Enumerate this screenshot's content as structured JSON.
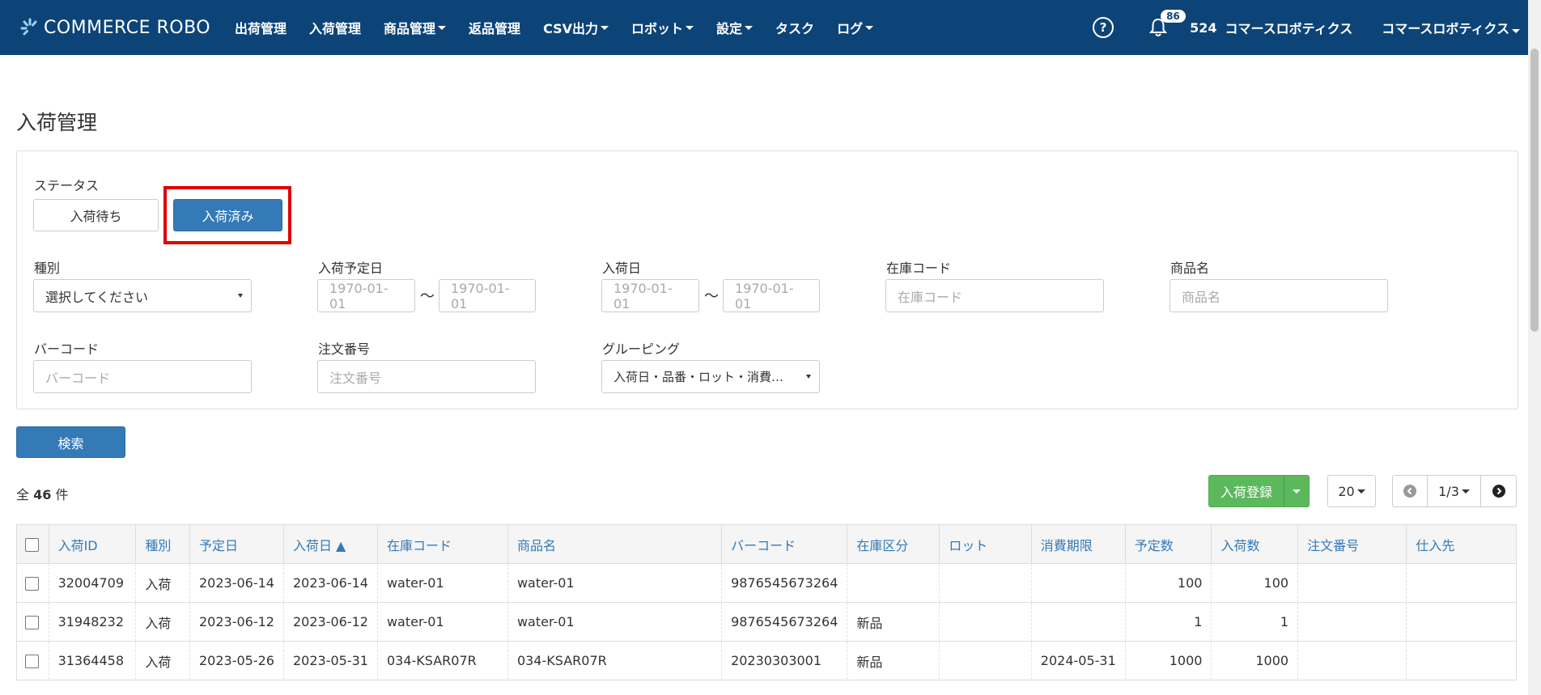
{
  "nav": {
    "brand": "COMMERCE ROBO",
    "items": [
      {
        "label": "出荷管理",
        "caret": false
      },
      {
        "label": "入荷管理",
        "caret": false
      },
      {
        "label": "商品管理",
        "caret": true
      },
      {
        "label": "返品管理",
        "caret": false
      },
      {
        "label": "CSV出力",
        "caret": true
      },
      {
        "label": "ロボット",
        "caret": true
      },
      {
        "label": "設定",
        "caret": true
      },
      {
        "label": "タスク",
        "caret": false
      },
      {
        "label": "ログ",
        "caret": true
      }
    ],
    "help_icon": "question-circle-icon",
    "bell_icon": "bell-icon",
    "notification_count": "86",
    "account_id": "524",
    "account_name": "コマースロボティクス",
    "user_menu": "コマースロボティクス"
  },
  "page": {
    "title": "入荷管理"
  },
  "filters": {
    "status_label": "ステータス",
    "status_options": [
      "入荷待ち",
      "入荷済み"
    ],
    "status_selected": "入荷済み",
    "type_label": "種別",
    "type_value": "選択してください",
    "scheduled_label": "入荷予定日",
    "scheduled_from": "1970-01-01",
    "scheduled_to": "1970-01-01",
    "arrival_label": "入荷日",
    "arrival_from": "1970-01-01",
    "arrival_to": "1970-01-01",
    "stock_code_label": "在庫コード",
    "stock_code_placeholder": "在庫コード",
    "product_name_label": "商品名",
    "product_name_placeholder": "商品名",
    "barcode_label": "バーコード",
    "barcode_placeholder": "バーコード",
    "order_no_label": "注文番号",
    "order_no_placeholder": "注文番号",
    "grouping_label": "グルーピング",
    "grouping_value": "入荷日・品番・ロット・消費…",
    "range_sep": "〜",
    "search_button": "検索"
  },
  "results": {
    "total_prefix": "全",
    "total_count": "46",
    "total_suffix": "件",
    "register_button": "入荷登録",
    "page_size": "20",
    "page_indicator": "1/3"
  },
  "table": {
    "columns": [
      "入荷ID",
      "種別",
      "予定日",
      "入荷日 ▲",
      "在庫コード",
      "商品名",
      "バーコード",
      "在庫区分",
      "ロット",
      "消費期限",
      "予定数",
      "入荷数",
      "注文番号",
      "仕入先"
    ],
    "rows": [
      [
        "32004709",
        "入荷",
        "2023-06-14",
        "2023-06-14",
        "water-01",
        "water-01",
        "9876545673264",
        "",
        "",
        "",
        "100",
        "100",
        "",
        ""
      ],
      [
        "31948232",
        "入荷",
        "2023-06-12",
        "2023-06-12",
        "water-01",
        "water-01",
        "9876545673264",
        "新品",
        "",
        "",
        "1",
        "1",
        "",
        ""
      ],
      [
        "31364458",
        "入荷",
        "2023-05-26",
        "2023-05-31",
        "034-KSAR07R",
        "034-KSAR07R",
        "20230303001",
        "新品",
        "",
        "2024-05-31",
        "1000",
        "1000",
        "",
        ""
      ]
    ]
  }
}
